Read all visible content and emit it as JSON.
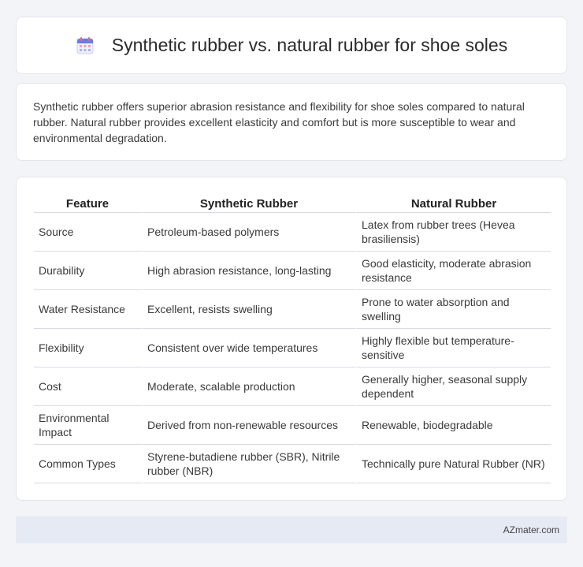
{
  "header": {
    "title": "Synthetic rubber vs. natural rubber for shoe soles",
    "icon": "calendar-icon"
  },
  "summary": {
    "text": "Synthetic rubber offers superior abrasion resistance and flexibility for shoe soles compared to natural rubber. Natural rubber provides excellent elasticity and comfort but is more susceptible to wear and environmental degradation."
  },
  "table": {
    "headers": [
      "Feature",
      "Synthetic Rubber",
      "Natural Rubber"
    ],
    "rows": [
      [
        "Source",
        "Petroleum-based polymers",
        "Latex from rubber trees (Hevea brasiliensis)"
      ],
      [
        "Durability",
        "High abrasion resistance, long-lasting",
        "Good elasticity, moderate abrasion resistance"
      ],
      [
        "Water Resistance",
        "Excellent, resists swelling",
        "Prone to water absorption and swelling"
      ],
      [
        "Flexibility",
        "Consistent over wide temperatures",
        "Highly flexible but temperature-sensitive"
      ],
      [
        "Cost",
        "Moderate, scalable production",
        "Generally higher, seasonal supply dependent"
      ],
      [
        "Environmental Impact",
        "Derived from non-renewable resources",
        "Renewable, biodegradable"
      ],
      [
        "Common Types",
        "Styrene-butadiene rubber (SBR), Nitrile rubber (NBR)",
        "Technically pure Natural Rubber (NR)"
      ]
    ]
  },
  "footer": {
    "text": "AZmater.com"
  },
  "colors": {
    "background": "#f3f4f8",
    "footer_bg": "#e6eaf5"
  }
}
